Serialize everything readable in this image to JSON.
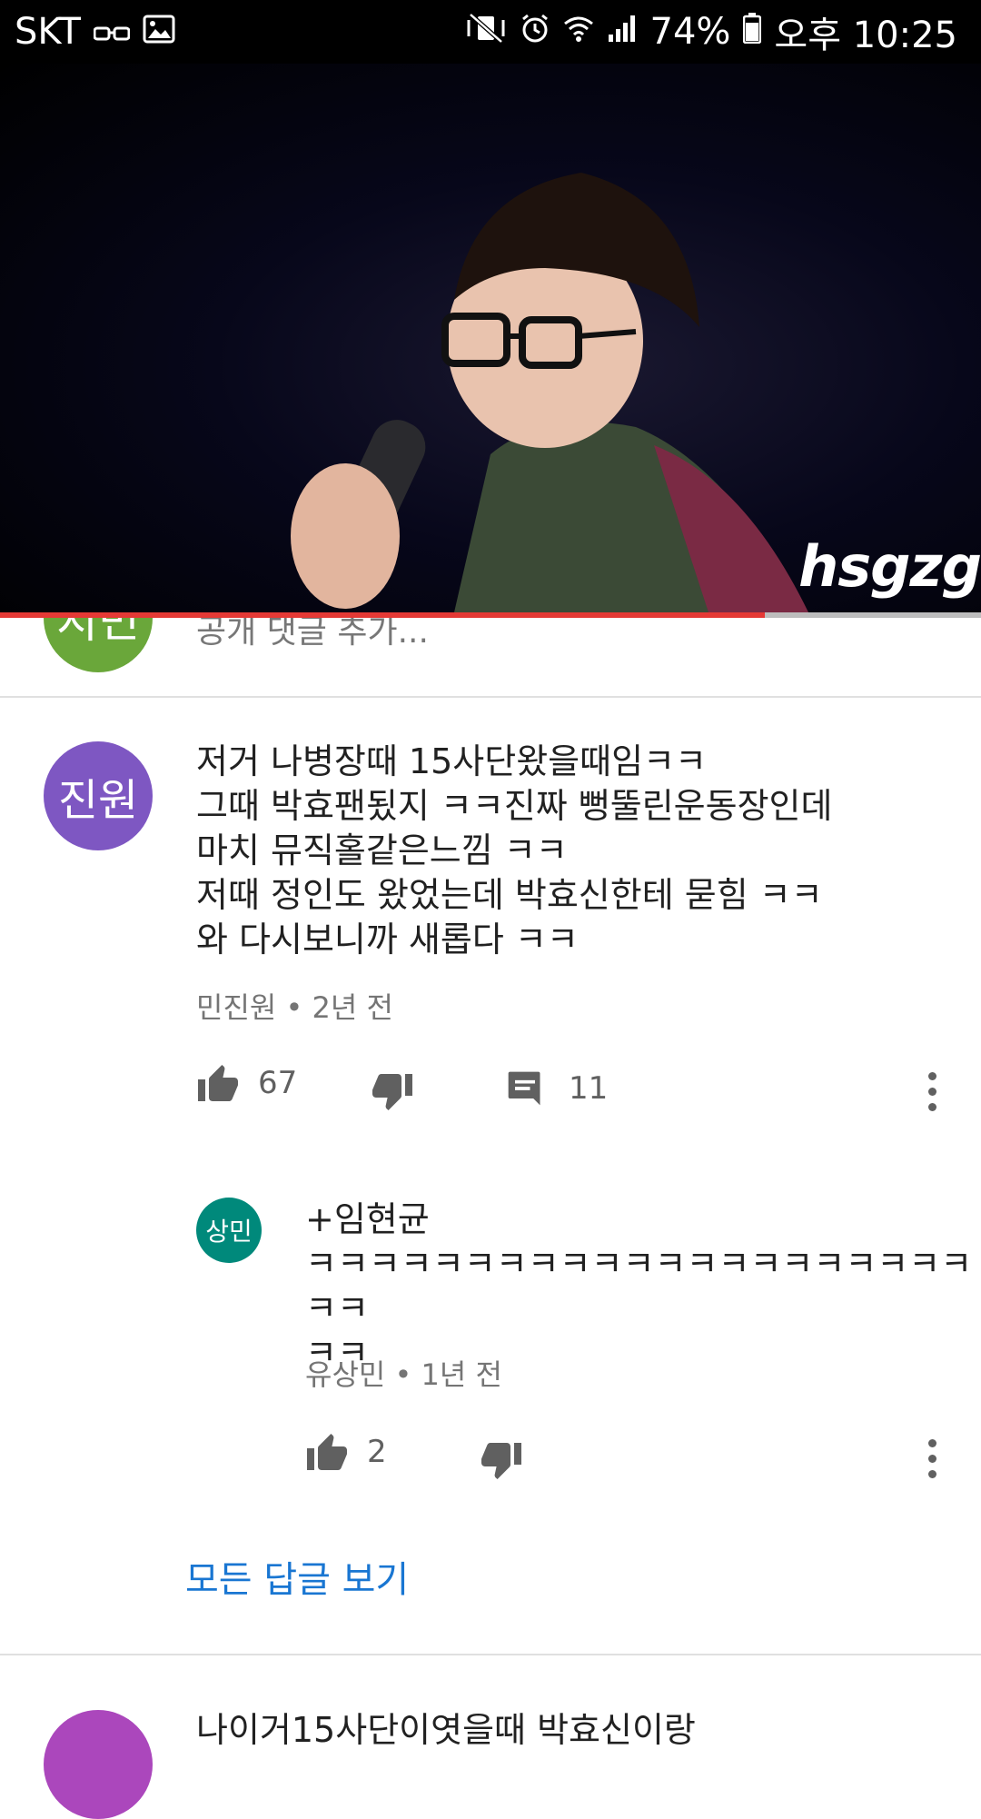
{
  "status_bar": {
    "carrier": "SKT",
    "battery": "74%",
    "time": "오후 10:25"
  },
  "video": {
    "watermark": "hsgzg",
    "progress_fraction": 0.78,
    "progress_color": "#e53935"
  },
  "add_comment": {
    "avatar_text": "지민",
    "avatar_color": "#6aa73a",
    "placeholder": "공개 댓글 추가..."
  },
  "comment": {
    "avatar_text": "진원",
    "avatar_color": "#7e57c2",
    "lines": [
      "저거 나병장때 15사단왔을때임ㅋㅋ",
      "그때 박효팬됬지 ㅋㅋ진짜 뻥뚤린운동장인데",
      "마치 뮤직홀같은느낌 ㅋㅋ",
      "저때 정인도 왔었는데 박효신한테 묻힘 ㅋㅋ",
      "와 다시보니까 새롭다 ㅋㅋ"
    ],
    "author": "민진원",
    "time": "2년 전",
    "likes": "67",
    "replies": "11",
    "icons": [
      "thumb-up-icon",
      "thumb-down-icon",
      "reply-icon",
      "more-vert-icon"
    ]
  },
  "reply": {
    "avatar_text": "상민",
    "avatar_color": "#00897b",
    "mention": "+임현균",
    "lines": [
      "ㅋㅋㅋㅋㅋㅋㅋㅋㅋㅋㅋㅋㅋㅋㅋㅋㅋㅋㅋㅋㅋㅋㅋ",
      "ㅋㅋ"
    ],
    "author": "유상민",
    "time": "1년 전",
    "likes": "2"
  },
  "view_all_replies": "모든 답글 보기",
  "next_comment": {
    "avatar_color": "#ab47bc",
    "text": "나이거15사단이엿을때 박효신이랑"
  }
}
